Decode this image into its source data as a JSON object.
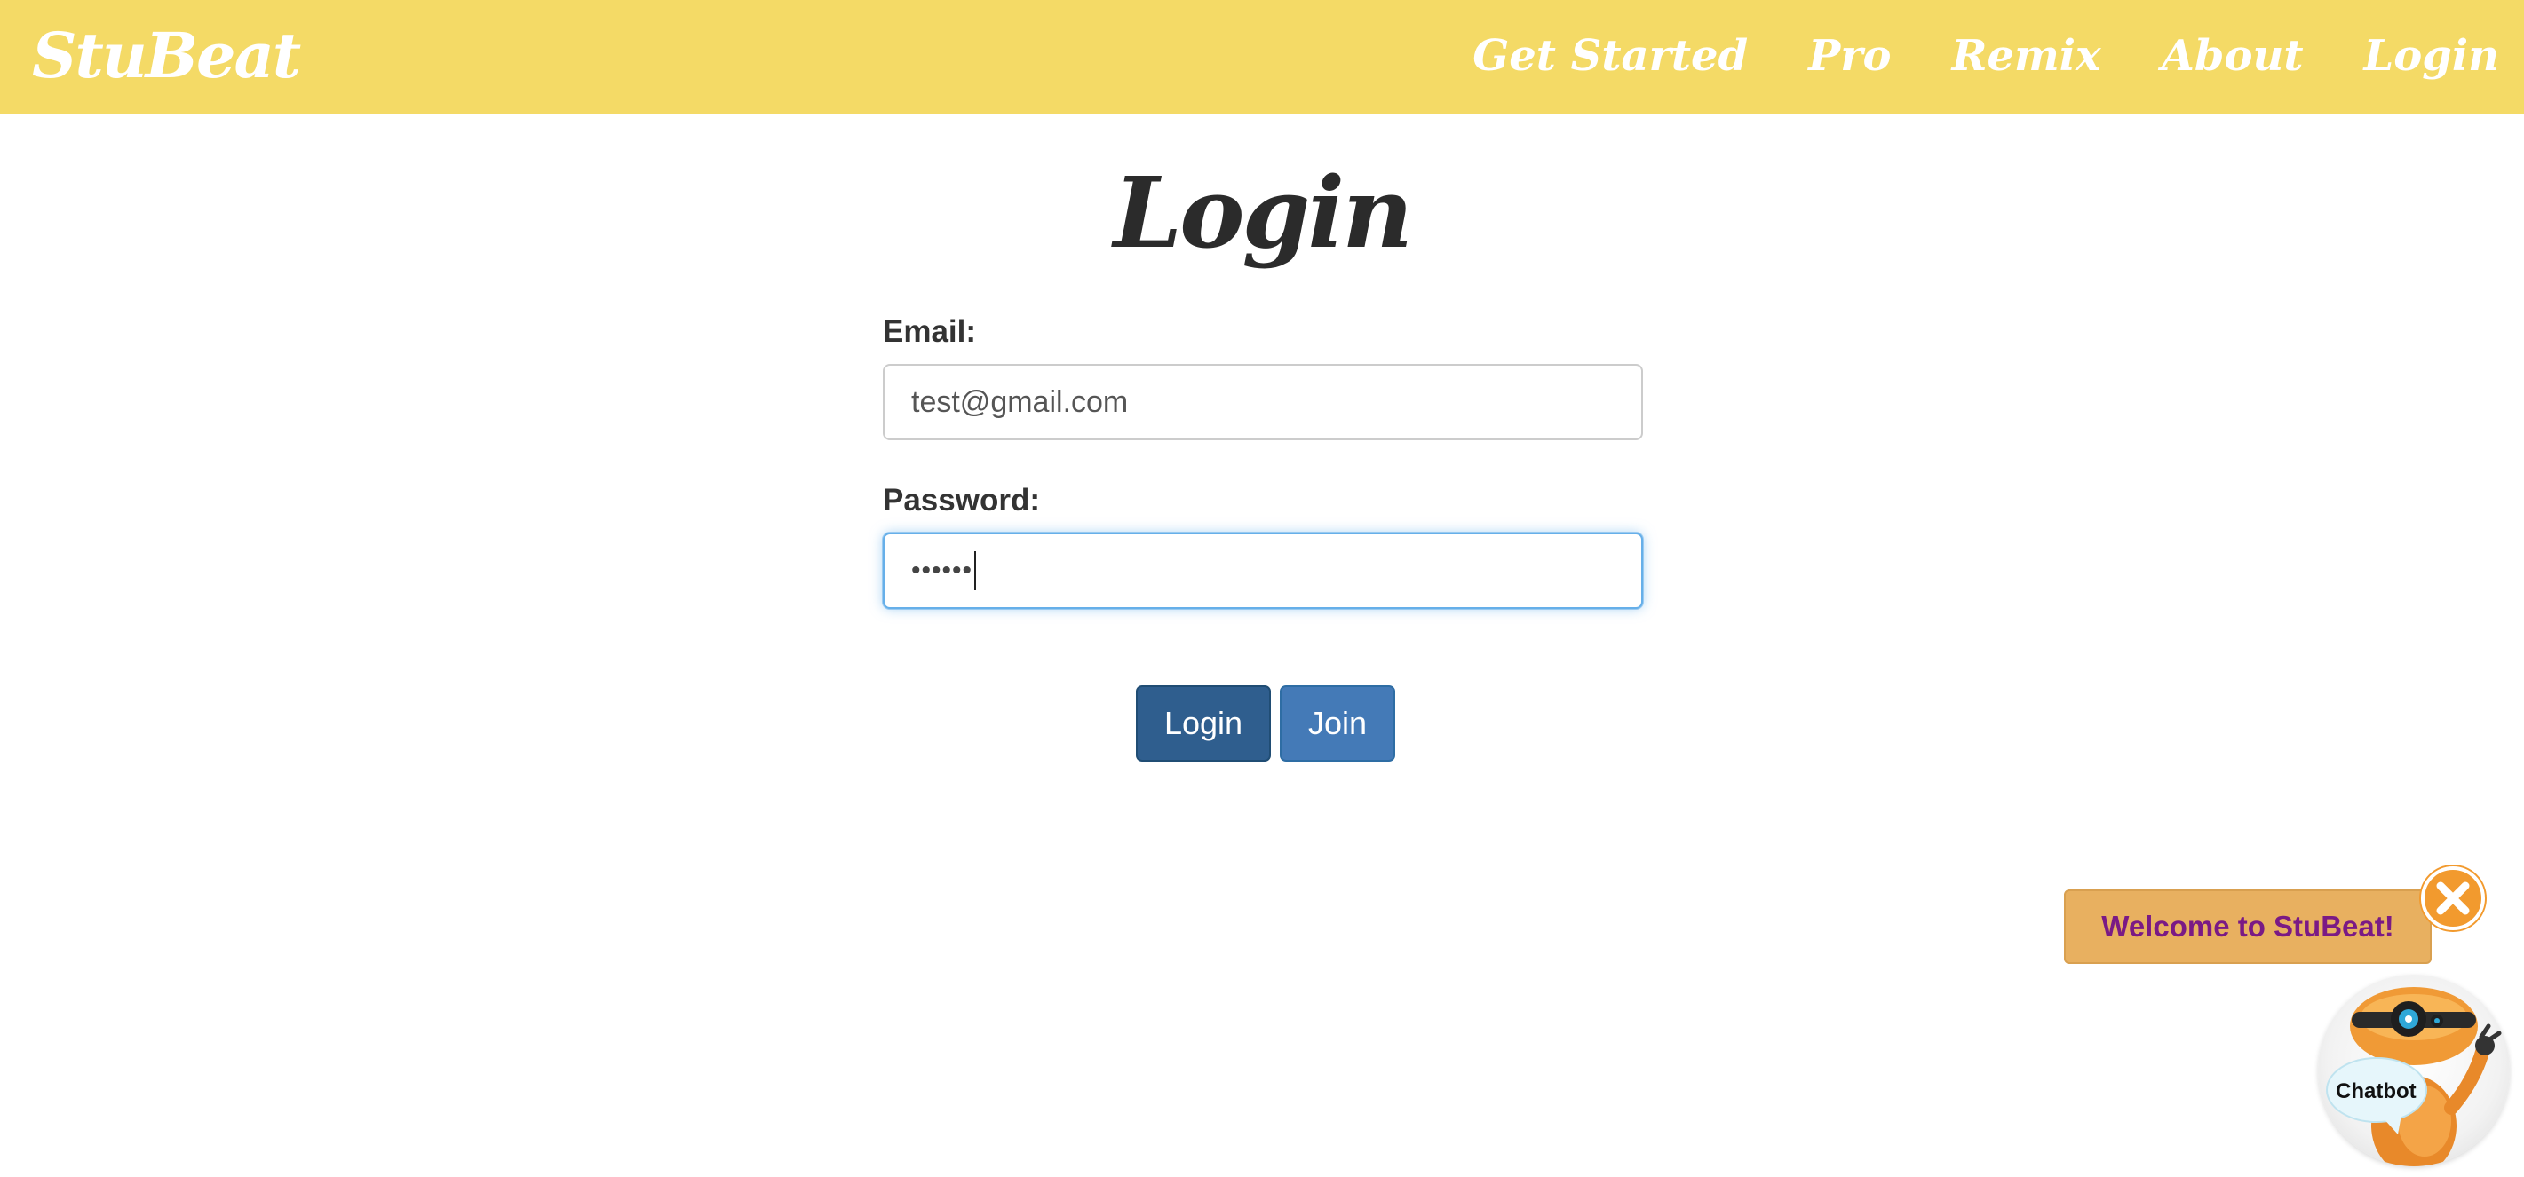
{
  "navbar": {
    "brand": "StuBeat",
    "items": [
      {
        "label": "Get Started"
      },
      {
        "label": "Pro"
      },
      {
        "label": "Remix"
      },
      {
        "label": "About"
      },
      {
        "label": "Login"
      }
    ]
  },
  "page": {
    "title": "Login"
  },
  "form": {
    "email": {
      "label": "Email:",
      "value": "test@gmail.com"
    },
    "password": {
      "label": "Password:",
      "masked_value": "••••••"
    }
  },
  "buttons": {
    "login_label": "Login",
    "join_label": "Join"
  },
  "chatbot": {
    "welcome_text": "Welcome to StuBeat!",
    "avatar_label": "Chatbot",
    "close_icon": "close-icon"
  },
  "colors": {
    "navbar_bg": "#f4da66",
    "login_button": "#2f5e8e",
    "join_button": "#447ab7",
    "welcome_bg": "#e8b060",
    "welcome_text": "#7a1a85",
    "close_button": "#f29a2e"
  }
}
